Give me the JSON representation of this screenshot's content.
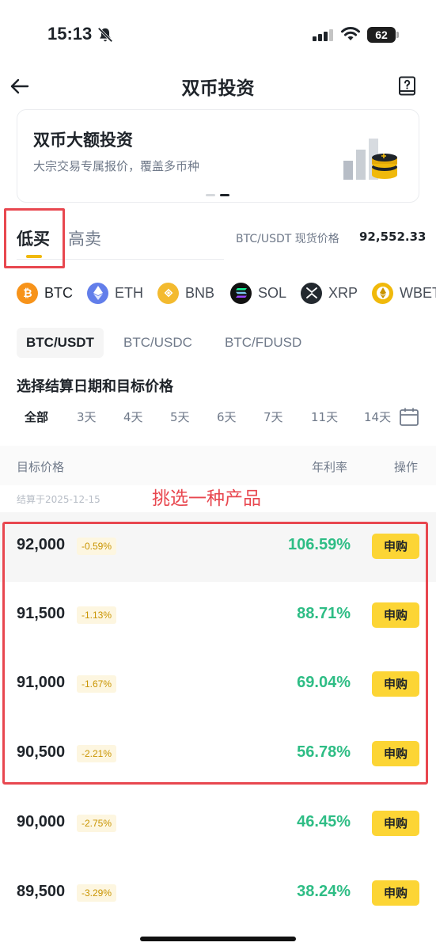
{
  "status_bar": {
    "time": "15:13",
    "battery": "62"
  },
  "header": {
    "title": "双币投资"
  },
  "banner": {
    "title": "双币大额投资",
    "subtitle": "大宗交易专属报价，覆盖多币种"
  },
  "tabs": [
    {
      "label": "低买"
    },
    {
      "label": "高卖"
    }
  ],
  "spot_price": {
    "label": "BTC/USDT 现货价格",
    "value": "92,552.33"
  },
  "coins": [
    {
      "label": "BTC",
      "color": "#f7931a"
    },
    {
      "label": "ETH",
      "color": "#627eea"
    },
    {
      "label": "BNB",
      "color": "#f3ba2f"
    },
    {
      "label": "SOL",
      "color": "#14f195"
    },
    {
      "label": "XRP",
      "color": "#23292f"
    },
    {
      "label": "WBETH",
      "color": "#f0b90b"
    }
  ],
  "pairs": [
    {
      "label": "BTC/USDT"
    },
    {
      "label": "BTC/USDC"
    },
    {
      "label": "BTC/FDUSD"
    }
  ],
  "date_section": {
    "title": "选择结算日期和目标价格",
    "days": [
      "全部",
      "3天",
      "4天",
      "5天",
      "6天",
      "7天",
      "11天",
      "14天"
    ]
  },
  "list": {
    "col_target": "目标价格",
    "col_apr": "年利率",
    "col_op": "操作",
    "settle_date": "结算于2025-12-15",
    "annotation": "挑选一种产品",
    "rows": [
      {
        "price": "92,000",
        "change": "-0.59%",
        "apr": "106.59%",
        "action": "申购"
      },
      {
        "price": "91,500",
        "change": "-1.13%",
        "apr": "88.71%",
        "action": "申购"
      },
      {
        "price": "91,000",
        "change": "-1.67%",
        "apr": "69.04%",
        "action": "申购"
      },
      {
        "price": "90,500",
        "change": "-2.21%",
        "apr": "56.78%",
        "action": "申购"
      },
      {
        "price": "90,000",
        "change": "-2.75%",
        "apr": "46.45%",
        "action": "申购"
      },
      {
        "price": "89,500",
        "change": "-3.29%",
        "apr": "38.24%",
        "action": "申购"
      }
    ]
  },
  "colors": {
    "accent": "#fcd535",
    "positive": "#2ebd85",
    "annotation": "#e8474f"
  }
}
